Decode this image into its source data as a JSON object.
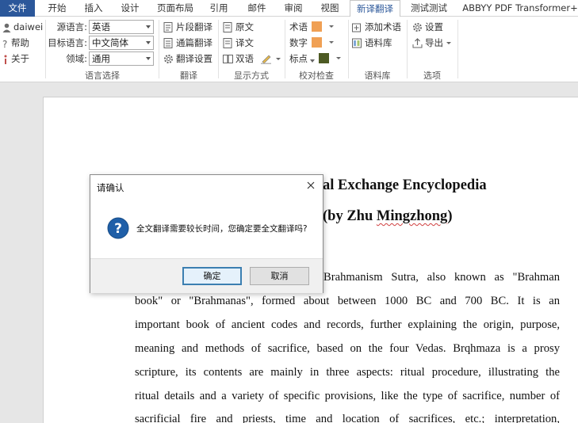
{
  "ribbon_tabs": [
    "文件",
    "开始",
    "插入",
    "设计",
    "页面布局",
    "引用",
    "邮件",
    "审阅",
    "视图",
    "新译翻译",
    "测试测试",
    "ABBYY PDF Transformer+"
  ],
  "active_tab": "新译翻译",
  "accent_color": "#2b579a",
  "user": {
    "name": "daiwei",
    "help": "帮助",
    "about": "关于"
  },
  "lang_select": {
    "source_label": "源语言:",
    "source_value": "英语",
    "target_label": "目标语言:",
    "target_value": "中文简体",
    "domain_label": "领域:",
    "domain_value": "通用",
    "group_label": "语言选择"
  },
  "translate": {
    "segment": "片段翻译",
    "full": "通篇翻译",
    "settings": "翻译设置",
    "group_label": "翻译"
  },
  "display": {
    "original": "原文",
    "translation": "译文",
    "bilingual": "双语",
    "group_label": "显示方式"
  },
  "proofread": {
    "term": "术语",
    "term_color": "#f0a054",
    "number": "数字",
    "number_color": "#f0a054",
    "punct": "标点",
    "punct_color": "#4d5a23",
    "group_label": "校对检查"
  },
  "corpus": {
    "add_term": "添加术语",
    "library": "语料库",
    "group_label": "语料库"
  },
  "options": {
    "settings": "设置",
    "export": "导出",
    "group_label": "选项"
  },
  "document": {
    "title_line1": "al Exchange Encyclopedia",
    "title_line2_prefix": "(by Zhu ",
    "title_line2_name": "Mingzhong",
    "title_line2_suffix": ")",
    "paragraph_line1": "Brahmanism Sutra, also known as \"Brahman",
    "paragraph_lines": [
      "book\" or \"Brahmanas\", formed about between 1000 BC and 700 BC. It is an",
      "important book of ancient codes and records, further explaining the origin, purpose,",
      "meaning and methods of sacrifice, based on the four Vedas. Brqhmaza is a prosy",
      "scripture, its contents are mainly in three aspects: ritual procedure, illustrating the",
      "ritual details and a variety of specific provisions, like the type of sacrifice, number of",
      "sacrificial fire and priests, time and location of sacrifices, etc.; interpretation,"
    ]
  },
  "dialog": {
    "title": "请确认",
    "message": "全文翻译需要较长时间，您确定要全文翻译吗?",
    "ok": "确定",
    "cancel": "取消"
  }
}
